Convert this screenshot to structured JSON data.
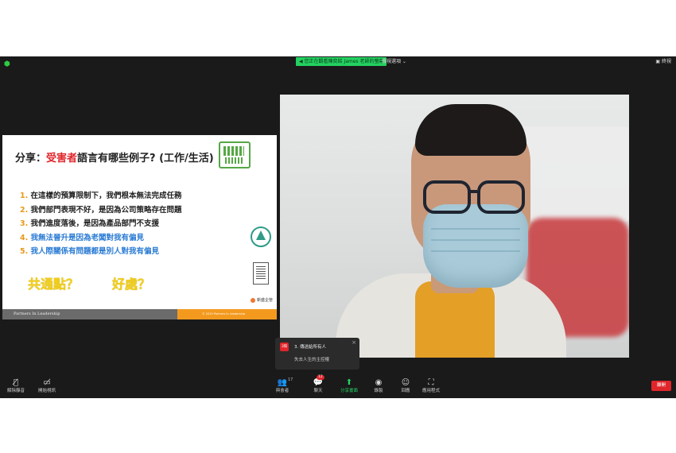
{
  "top_bar": {
    "banner": "◀ 您正在觀看陳奕銘 James 老師的螢幕",
    "view_options": "檢視選項 ⌄",
    "fullscreen": "▣ 終視"
  },
  "slide": {
    "title_prefix": "分享：",
    "title_highlight": "受害者",
    "title_suffix": "語言有哪些例子? (工作/生活)",
    "items": [
      {
        "num": "1.",
        "text": "在這樣的預算限制下，我們根本無法完成任務"
      },
      {
        "num": "2.",
        "text": "我們部門表現不好，是因為公司策略存在問題"
      },
      {
        "num": "3.",
        "text": "我們進度落後，是因為產品部門不支援"
      },
      {
        "num": "4.",
        "text": "我無法晉升是因為老闆對我有偏見"
      },
      {
        "num": "5.",
        "text": "我人際關係有問題都是別人對我有偏見"
      }
    ],
    "highlight_1": "共通點？",
    "highlight_2": "好處？",
    "logo_text": "新盛企管",
    "footer_left": "Partners In Leadership",
    "footer_right": "© 2019 Partners In Leadership"
  },
  "chat_notification": {
    "avatar": "3筒",
    "title": "3. 傳送給所有人",
    "message": "失去人生的主控權",
    "close": "×"
  },
  "toolbar": {
    "mute": "解除靜音",
    "video": "開始視訊",
    "participants": "與會者",
    "participants_count": "17",
    "chat": "聊天",
    "chat_badge": "12",
    "share": "分享畫面",
    "record": "錄製",
    "reactions": "回應",
    "apps": "應用程式",
    "end": "離開"
  },
  "colors": {
    "accent_green": "#23d160",
    "end_red": "#e0262b",
    "slide_orange": "#f39a1e",
    "slide_blue": "#2a7bd4",
    "slide_yellow": "#f2cf1a"
  },
  "icons": [
    "shield-icon",
    "microphone-muted-icon",
    "camera-off-icon",
    "participants-icon",
    "chat-icon",
    "share-screen-icon",
    "record-icon",
    "reactions-icon",
    "apps-icon"
  ]
}
